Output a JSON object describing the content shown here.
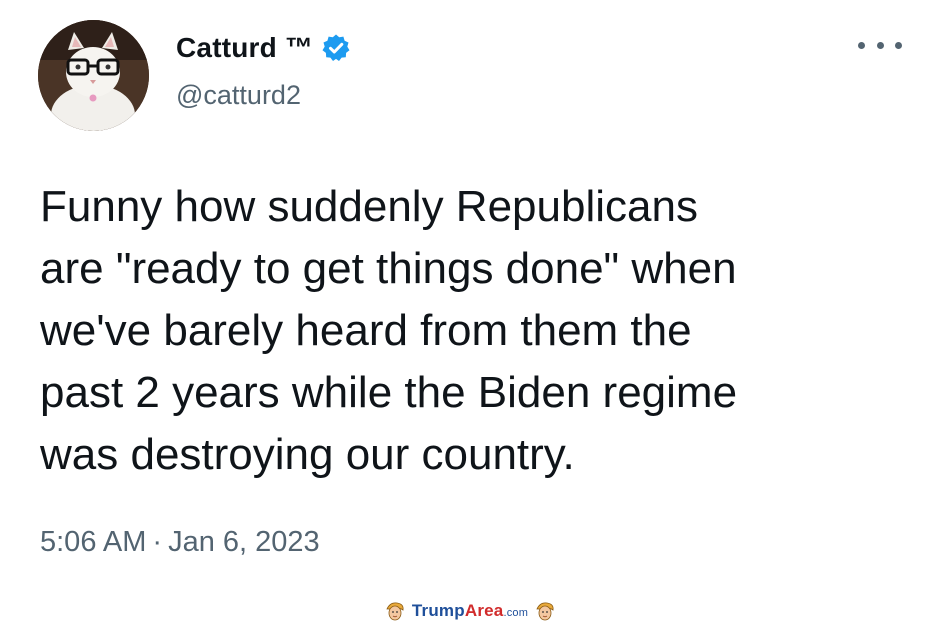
{
  "author": {
    "display_name": "Catturd ™",
    "handle": "@catturd2",
    "avatar_icon": "cat-with-glasses-avatar",
    "verified_icon": "verified-badge-icon"
  },
  "tweet": {
    "text": "Funny how suddenly Republicans\nare \"ready to get things done\" when\nwe've barely heard from them the\npast 2 years while the Biden regime\nwas destroying our country.",
    "time": "5:06 AM",
    "separator": "·",
    "date": "Jan 6, 2023"
  },
  "menu": {
    "icon": "more-options-icon"
  },
  "watermark": {
    "brand_part1": "Trump",
    "brand_part2": "Area",
    "brand_suffix": ".com"
  },
  "colors": {
    "text_primary": "#0f1419",
    "text_secondary": "#536471",
    "verified_blue": "#1d9bf0",
    "watermark_blue": "#1f4f9a",
    "watermark_red": "#d12b2b"
  }
}
